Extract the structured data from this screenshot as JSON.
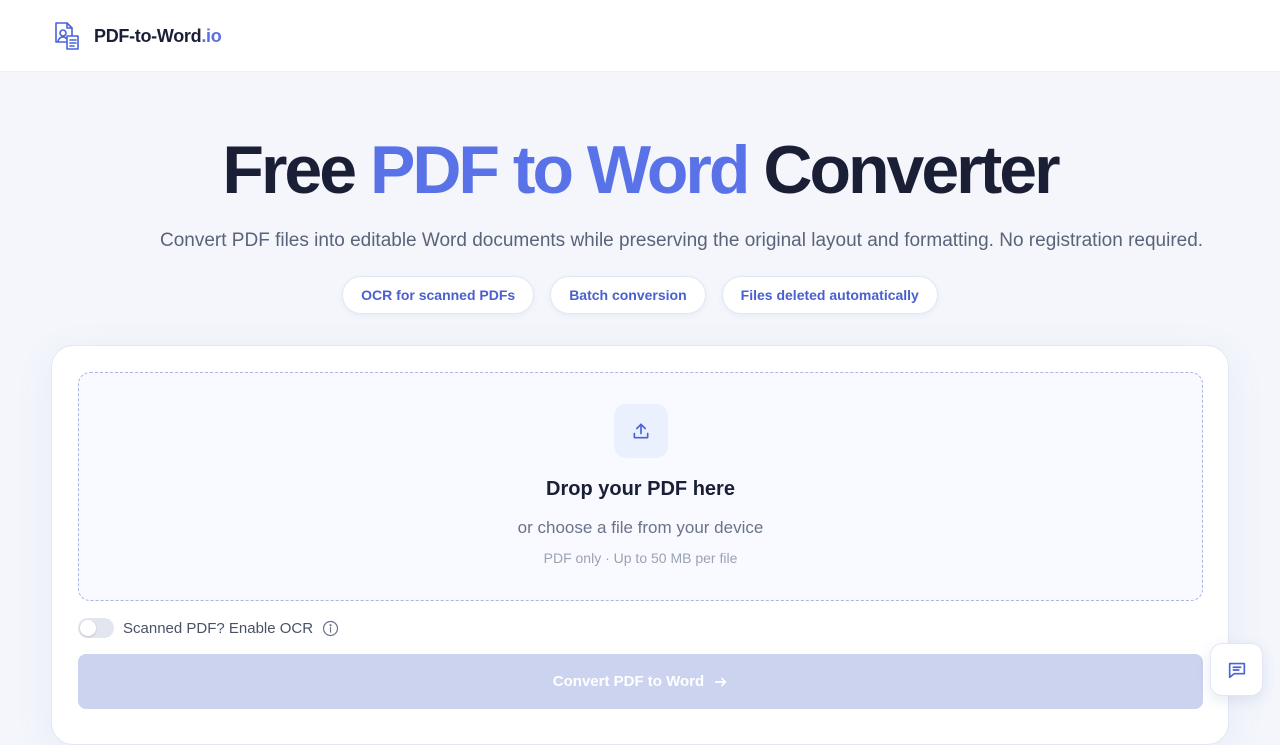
{
  "brand": {
    "name": "PDF-to-Word",
    "tld": ".io",
    "accent_color": "#5a72e8",
    "logo_icon": "document-convert-icon"
  },
  "hero": {
    "title_part1": "Free",
    "title_accent": "PDF to Word",
    "title_part2": "Converter",
    "subtitle": "Convert PDF files into editable Word documents while preserving the original layout and formatting. No registration required."
  },
  "features": [
    {
      "label": "OCR for scanned PDFs"
    },
    {
      "label": "Batch conversion"
    },
    {
      "label": "Files deleted automatically"
    }
  ],
  "uploader": {
    "icon": "upload-icon",
    "title": "Drop your PDF here",
    "subtitle": "or choose a file from your device",
    "note": "PDF only · Up to 50 MB per file"
  },
  "ocr": {
    "label": "Scanned PDF? Enable OCR",
    "enabled": false,
    "info_icon": "info-icon"
  },
  "convert_button": {
    "label": "Convert PDF to Word",
    "icon": "arrow-right-icon",
    "disabled": true
  },
  "chat": {
    "icon": "chat-icon"
  }
}
